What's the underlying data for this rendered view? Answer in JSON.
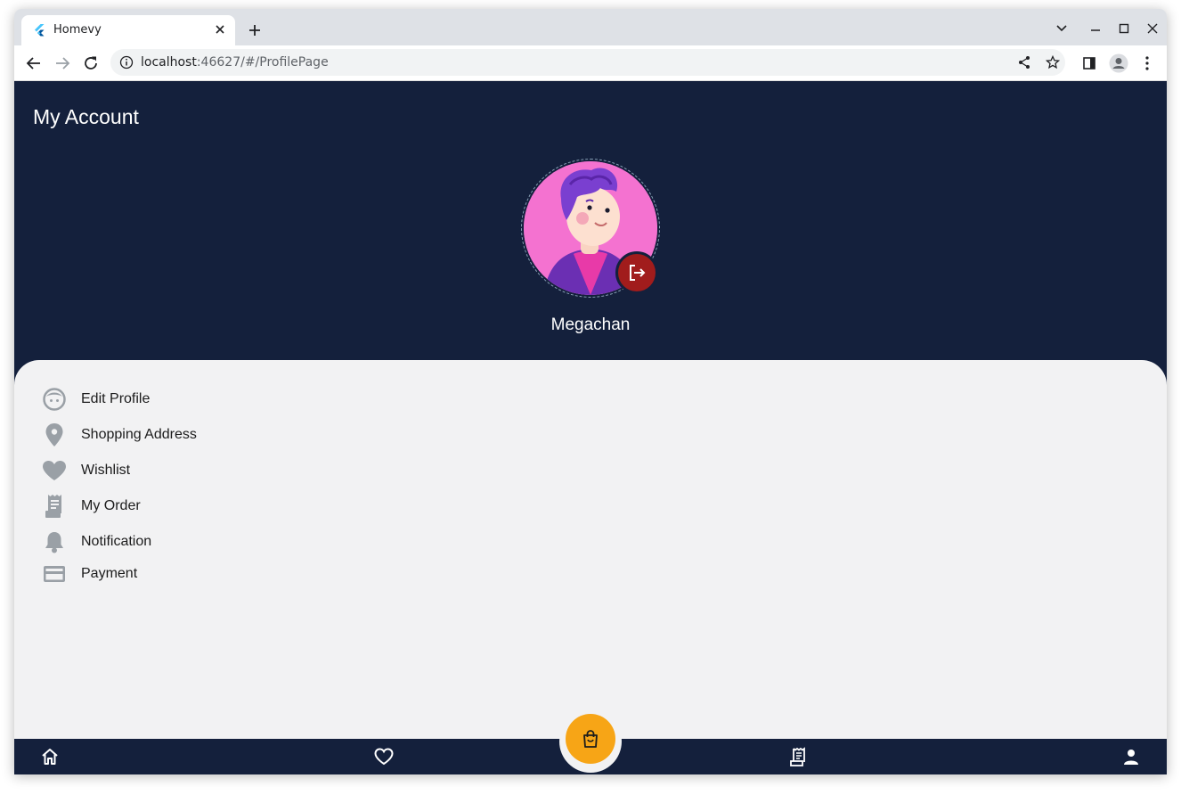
{
  "browser": {
    "tab_title": "Homevy",
    "url_host": "localhost",
    "url_rest": ":46627/#/ProfilePage"
  },
  "app": {
    "page_title": "My Account",
    "user_name": "Megachan",
    "menu": [
      {
        "label": "Edit Profile",
        "icon": "face-icon"
      },
      {
        "label": "Shopping Address",
        "icon": "location-pin-icon"
      },
      {
        "label": "Wishlist",
        "icon": "heart-icon"
      },
      {
        "label": "My Order",
        "icon": "receipt-icon"
      },
      {
        "label": "Notification",
        "icon": "bell-icon"
      },
      {
        "label": "Payment",
        "icon": "credit-card-icon"
      }
    ],
    "bottom_nav": [
      {
        "name": "home",
        "icon": "home-icon"
      },
      {
        "name": "wishlist",
        "icon": "heart-outline-icon"
      },
      {
        "name": "cart",
        "icon": "shopping-bag-icon"
      },
      {
        "name": "orders",
        "icon": "receipt-icon"
      },
      {
        "name": "profile",
        "icon": "person-icon"
      }
    ]
  },
  "colors": {
    "header_bg": "#14203c",
    "panel_bg": "#f2f2f3",
    "accent": "#f7a516",
    "logout": "#a11c1c",
    "menu_icon": "#9aa0a6"
  }
}
